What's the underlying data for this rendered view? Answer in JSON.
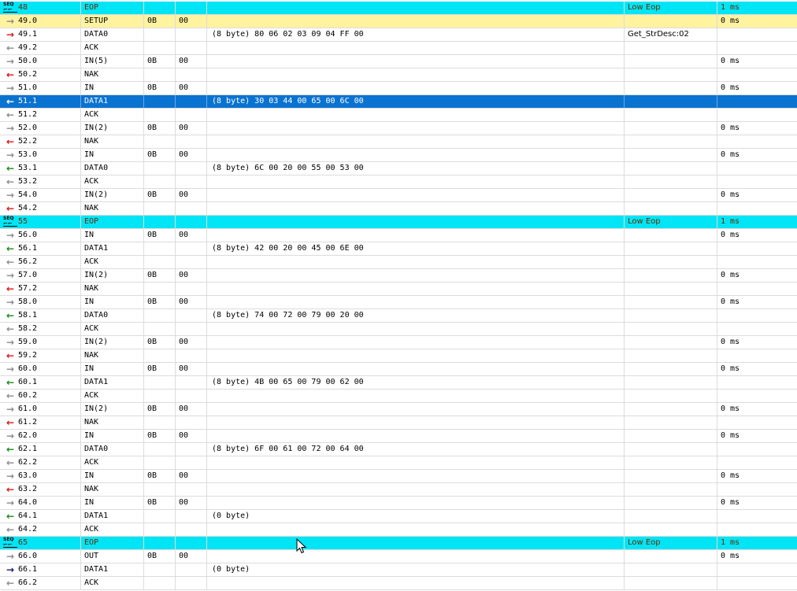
{
  "colors": {
    "sof_row": "#00e5f5",
    "setup_row": "#fff3a0",
    "selected_row": "#0a73d0"
  },
  "rows": [
    {
      "type": "sof",
      "dir": "sof-icon",
      "seq": "48",
      "pid": "EOP",
      "c2": "",
      "c3": "",
      "data": "",
      "status": "Low Eop",
      "time": "1 ms"
    },
    {
      "type": "setup",
      "dir": "gray",
      "seq": "49.0",
      "pid": "SETUP",
      "c2": "0B",
      "c3": "00",
      "data": "",
      "status": "",
      "time": "0 ms"
    },
    {
      "type": "normal",
      "dir": "red",
      "seq": "49.1",
      "pid": "DATA0",
      "c2": "",
      "c3": "",
      "data": "(8 byte) 80 06 02 03 09 04 FF 00",
      "status": "Get_StrDesc:02",
      "time": ""
    },
    {
      "type": "normal",
      "dir": "gray",
      "seq": "49.2",
      "pid": "ACK",
      "c2": "",
      "c3": "",
      "data": "",
      "status": "",
      "time": ""
    },
    {
      "type": "normal",
      "dir": "gray",
      "seq": "50.0",
      "pid": "IN(5)",
      "c2": "0B",
      "c3": "00",
      "data": "",
      "status": "",
      "time": "0 ms"
    },
    {
      "type": "normal",
      "dir": "red",
      "seq": "50.2",
      "pid": "NAK",
      "c2": "",
      "c3": "",
      "data": "",
      "status": "",
      "time": ""
    },
    {
      "type": "normal",
      "dir": "gray",
      "seq": "51.0",
      "pid": "IN",
      "c2": "0B",
      "c3": "00",
      "data": "",
      "status": "",
      "time": "0 ms"
    },
    {
      "type": "selected",
      "dir": "white",
      "seq": "51.1",
      "pid": "DATA1",
      "c2": "",
      "c3": "",
      "data": "(8 byte) 30 03 44 00 65 00 6C 00",
      "status": "",
      "time": ""
    },
    {
      "type": "normal",
      "dir": "gray",
      "seq": "51.2",
      "pid": "ACK",
      "c2": "",
      "c3": "",
      "data": "",
      "status": "",
      "time": ""
    },
    {
      "type": "normal",
      "dir": "gray",
      "seq": "52.0",
      "pid": "IN(2)",
      "c2": "0B",
      "c3": "00",
      "data": "",
      "status": "",
      "time": "0 ms"
    },
    {
      "type": "normal",
      "dir": "red",
      "seq": "52.2",
      "pid": "NAK",
      "c2": "",
      "c3": "",
      "data": "",
      "status": "",
      "time": ""
    },
    {
      "type": "normal",
      "dir": "gray",
      "seq": "53.0",
      "pid": "IN",
      "c2": "0B",
      "c3": "00",
      "data": "",
      "status": "",
      "time": "0 ms"
    },
    {
      "type": "normal",
      "dir": "green",
      "seq": "53.1",
      "pid": "DATA0",
      "c2": "",
      "c3": "",
      "data": "(8 byte) 6C 00 20 00 55 00 53 00",
      "status": "",
      "time": ""
    },
    {
      "type": "normal",
      "dir": "gray",
      "seq": "53.2",
      "pid": "ACK",
      "c2": "",
      "c3": "",
      "data": "",
      "status": "",
      "time": ""
    },
    {
      "type": "normal",
      "dir": "gray",
      "seq": "54.0",
      "pid": "IN(2)",
      "c2": "0B",
      "c3": "00",
      "data": "",
      "status": "",
      "time": "0 ms"
    },
    {
      "type": "normal",
      "dir": "red",
      "seq": "54.2",
      "pid": "NAK",
      "c2": "",
      "c3": "",
      "data": "",
      "status": "",
      "time": ""
    },
    {
      "type": "sof",
      "dir": "sof-icon",
      "seq": "55",
      "pid": "EOP",
      "c2": "",
      "c3": "",
      "data": "",
      "status": "Low Eop",
      "time": "1 ms"
    },
    {
      "type": "normal",
      "dir": "gray",
      "seq": "56.0",
      "pid": "IN",
      "c2": "0B",
      "c3": "00",
      "data": "",
      "status": "",
      "time": "0 ms"
    },
    {
      "type": "normal",
      "dir": "green",
      "seq": "56.1",
      "pid": "DATA1",
      "c2": "",
      "c3": "",
      "data": "(8 byte) 42 00 20 00 45 00 6E 00",
      "status": "",
      "time": ""
    },
    {
      "type": "normal",
      "dir": "gray",
      "seq": "56.2",
      "pid": "ACK",
      "c2": "",
      "c3": "",
      "data": "",
      "status": "",
      "time": ""
    },
    {
      "type": "normal",
      "dir": "gray",
      "seq": "57.0",
      "pid": "IN(2)",
      "c2": "0B",
      "c3": "00",
      "data": "",
      "status": "",
      "time": "0 ms"
    },
    {
      "type": "normal",
      "dir": "red",
      "seq": "57.2",
      "pid": "NAK",
      "c2": "",
      "c3": "",
      "data": "",
      "status": "",
      "time": ""
    },
    {
      "type": "normal",
      "dir": "gray",
      "seq": "58.0",
      "pid": "IN",
      "c2": "0B",
      "c3": "00",
      "data": "",
      "status": "",
      "time": "0 ms"
    },
    {
      "type": "normal",
      "dir": "green",
      "seq": "58.1",
      "pid": "DATA0",
      "c2": "",
      "c3": "",
      "data": "(8 byte) 74 00 72 00 79 00 20 00",
      "status": "",
      "time": ""
    },
    {
      "type": "normal",
      "dir": "gray",
      "seq": "58.2",
      "pid": "ACK",
      "c2": "",
      "c3": "",
      "data": "",
      "status": "",
      "time": ""
    },
    {
      "type": "normal",
      "dir": "gray",
      "seq": "59.0",
      "pid": "IN(2)",
      "c2": "0B",
      "c3": "00",
      "data": "",
      "status": "",
      "time": "0 ms"
    },
    {
      "type": "normal",
      "dir": "red",
      "seq": "59.2",
      "pid": "NAK",
      "c2": "",
      "c3": "",
      "data": "",
      "status": "",
      "time": ""
    },
    {
      "type": "normal",
      "dir": "gray",
      "seq": "60.0",
      "pid": "IN",
      "c2": "0B",
      "c3": "00",
      "data": "",
      "status": "",
      "time": "0 ms"
    },
    {
      "type": "normal",
      "dir": "green",
      "seq": "60.1",
      "pid": "DATA1",
      "c2": "",
      "c3": "",
      "data": "(8 byte) 4B 00 65 00 79 00 62 00",
      "status": "",
      "time": ""
    },
    {
      "type": "normal",
      "dir": "gray",
      "seq": "60.2",
      "pid": "ACK",
      "c2": "",
      "c3": "",
      "data": "",
      "status": "",
      "time": ""
    },
    {
      "type": "normal",
      "dir": "gray",
      "seq": "61.0",
      "pid": "IN(2)",
      "c2": "0B",
      "c3": "00",
      "data": "",
      "status": "",
      "time": "0 ms"
    },
    {
      "type": "normal",
      "dir": "red",
      "seq": "61.2",
      "pid": "NAK",
      "c2": "",
      "c3": "",
      "data": "",
      "status": "",
      "time": ""
    },
    {
      "type": "normal",
      "dir": "gray",
      "seq": "62.0",
      "pid": "IN",
      "c2": "0B",
      "c3": "00",
      "data": "",
      "status": "",
      "time": "0 ms"
    },
    {
      "type": "normal",
      "dir": "green",
      "seq": "62.1",
      "pid": "DATA0",
      "c2": "",
      "c3": "",
      "data": "(8 byte) 6F 00 61 00 72 00 64 00",
      "status": "",
      "time": ""
    },
    {
      "type": "normal",
      "dir": "gray",
      "seq": "62.2",
      "pid": "ACK",
      "c2": "",
      "c3": "",
      "data": "",
      "status": "",
      "time": ""
    },
    {
      "type": "normal",
      "dir": "gray",
      "seq": "63.0",
      "pid": "IN",
      "c2": "0B",
      "c3": "00",
      "data": "",
      "status": "",
      "time": "0 ms"
    },
    {
      "type": "normal",
      "dir": "red",
      "seq": "63.2",
      "pid": "NAK",
      "c2": "",
      "c3": "",
      "data": "",
      "status": "",
      "time": ""
    },
    {
      "type": "normal",
      "dir": "gray",
      "seq": "64.0",
      "pid": "IN",
      "c2": "0B",
      "c3": "00",
      "data": "",
      "status": "",
      "time": "0 ms"
    },
    {
      "type": "normal",
      "dir": "green",
      "seq": "64.1",
      "pid": "DATA1",
      "c2": "",
      "c3": "",
      "data": "(0 byte)",
      "status": "",
      "time": ""
    },
    {
      "type": "normal",
      "dir": "gray",
      "seq": "64.2",
      "pid": "ACK",
      "c2": "",
      "c3": "",
      "data": "",
      "status": "",
      "time": ""
    },
    {
      "type": "sof",
      "dir": "sof-icon",
      "seq": "65",
      "pid": "EOP",
      "c2": "",
      "c3": "",
      "data": "",
      "status": "Low Eop",
      "time": "1 ms"
    },
    {
      "type": "normal",
      "dir": "gray",
      "seq": "66.0",
      "pid": "OUT",
      "c2": "0B",
      "c3": "00",
      "data": "",
      "status": "",
      "time": "0 ms"
    },
    {
      "type": "normal",
      "dir": "navy",
      "seq": "66.1",
      "pid": "DATA1",
      "c2": "",
      "c3": "",
      "data": "(0 byte)",
      "status": "",
      "time": ""
    },
    {
      "type": "normal",
      "dir": "gray",
      "seq": "66.2",
      "pid": "ACK",
      "c2": "",
      "c3": "",
      "data": "",
      "status": "",
      "time": ""
    }
  ],
  "sof_icon_label": "SEQ"
}
